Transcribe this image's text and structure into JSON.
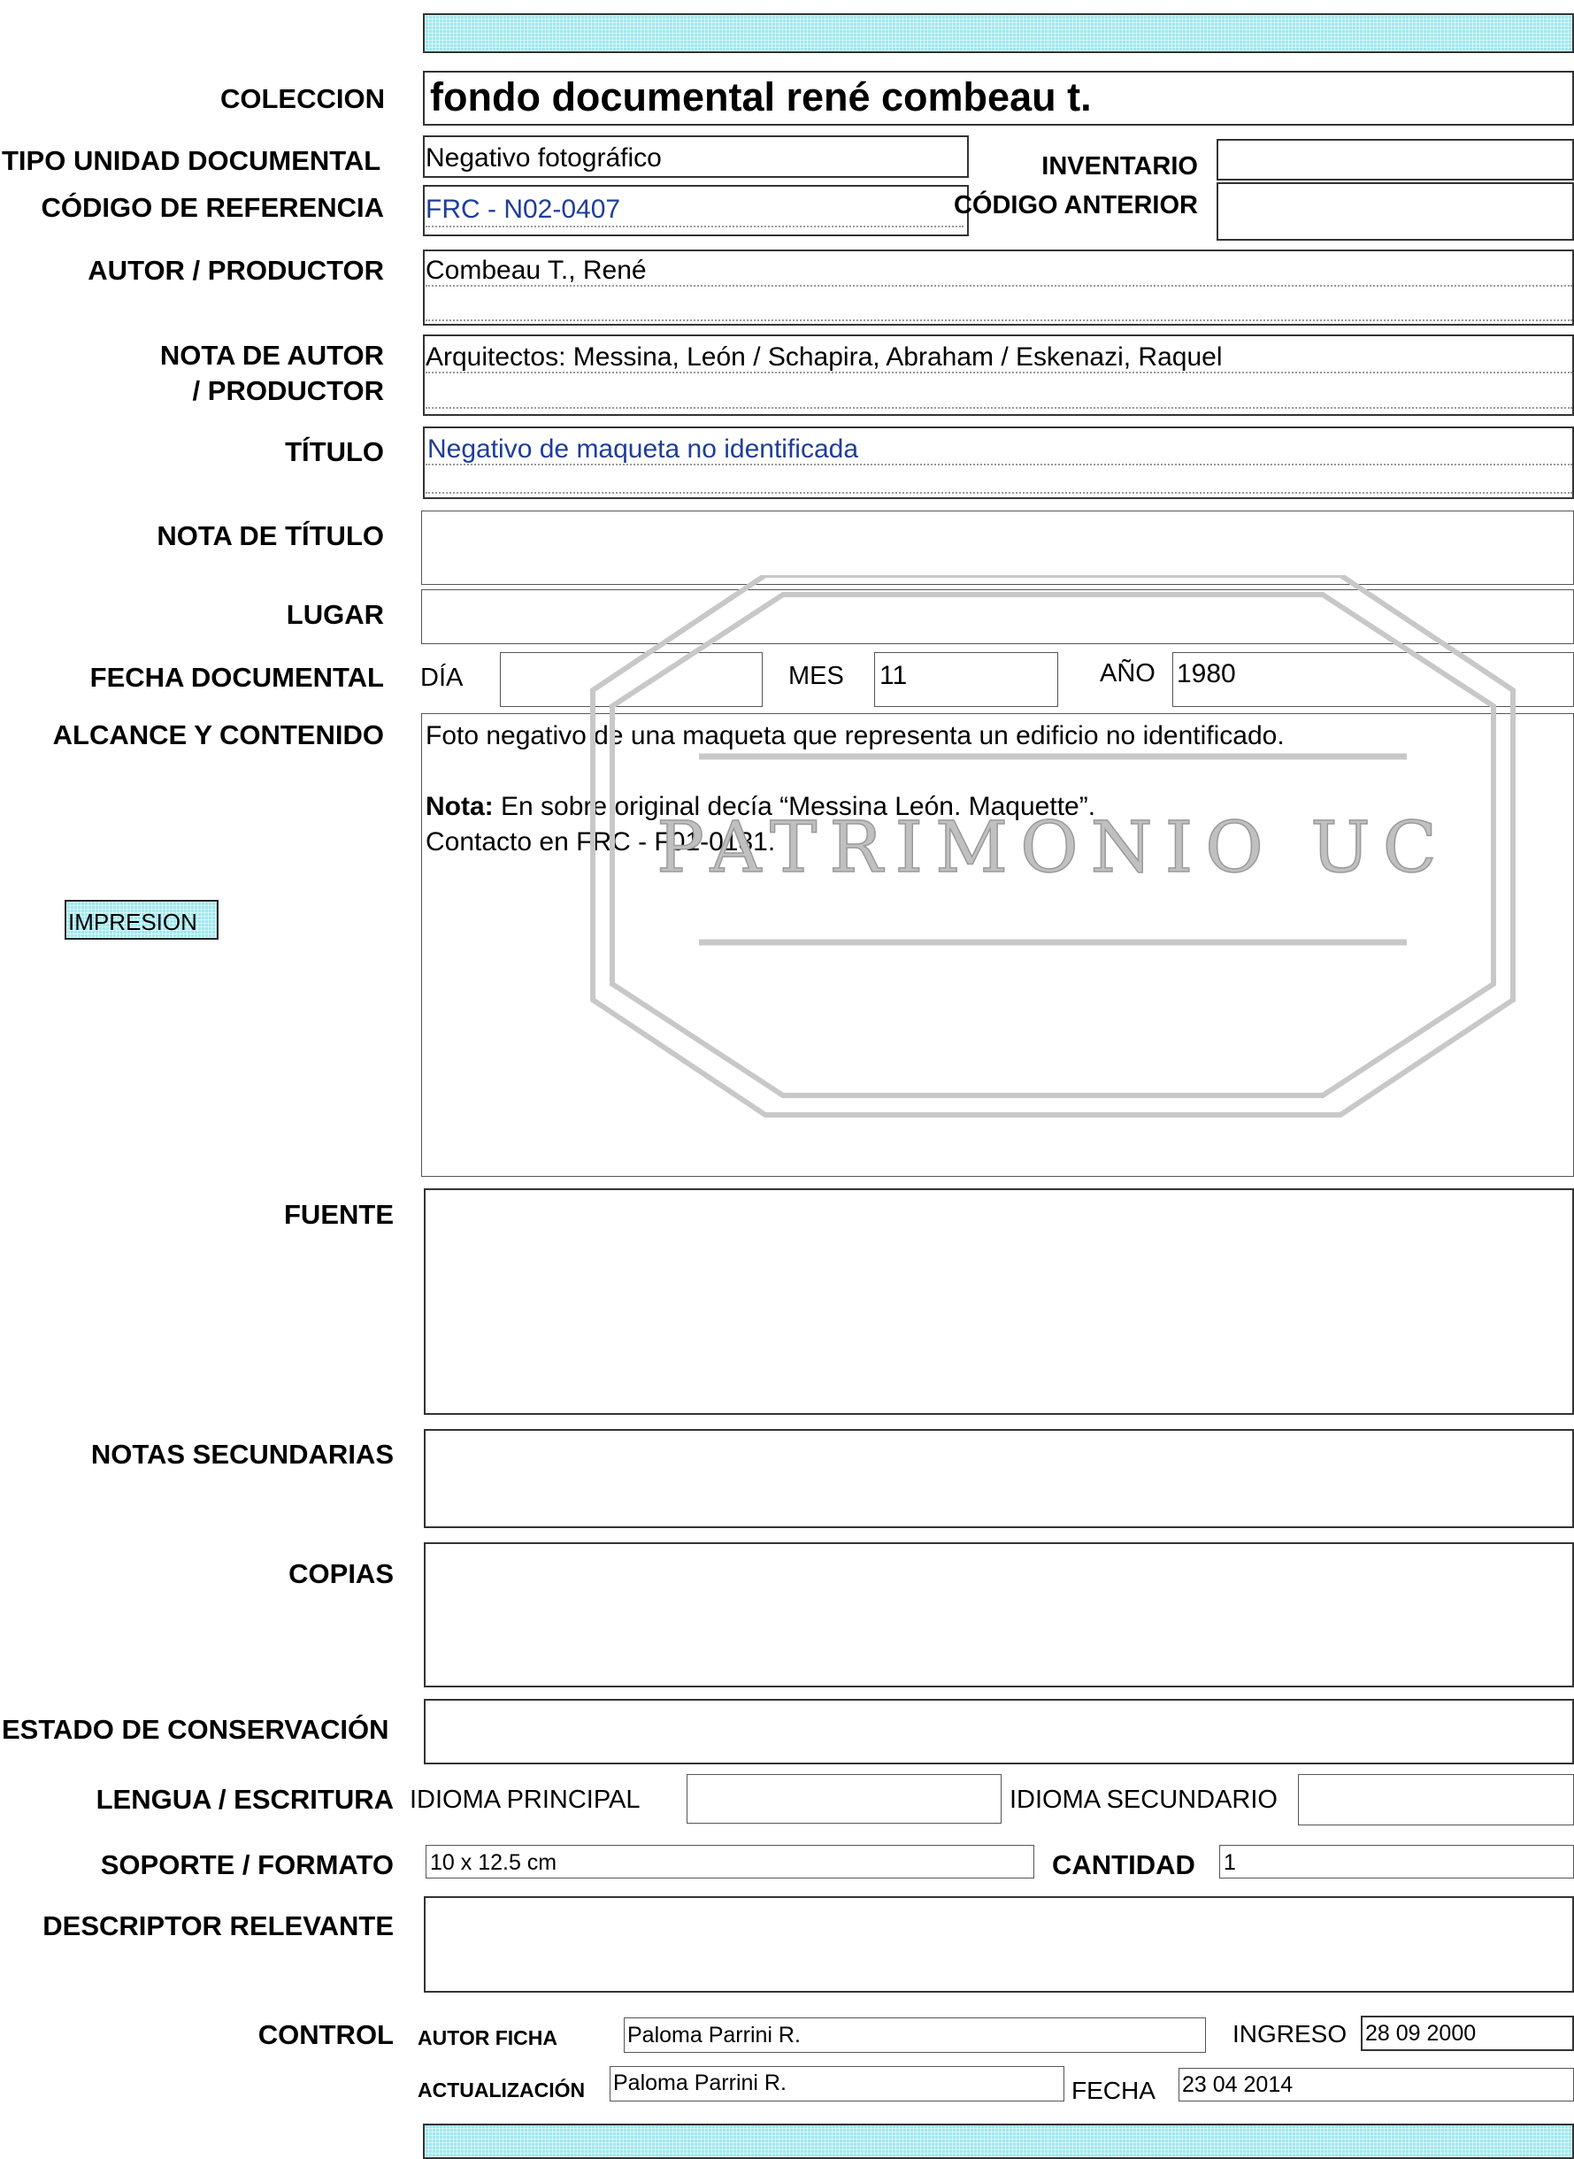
{
  "coleccion": {
    "label": "COLECCION",
    "value": "fondo documental rené combeau t."
  },
  "tipo_unidad": {
    "label": "TIPO UNIDAD DOCUMENTAL",
    "value": "Negativo fotográfico"
  },
  "inventario": {
    "label": "INVENTARIO",
    "value": ""
  },
  "codigo_referencia": {
    "label": "CÓDIGO DE REFERENCIA",
    "value": "FRC - N02-0407"
  },
  "codigo_anterior": {
    "label": "CÓDIGO ANTERIOR",
    "value": ""
  },
  "autor": {
    "label": "AUTOR / PRODUCTOR",
    "value": "Combeau T., René"
  },
  "nota_autor": {
    "label_line1": "NOTA DE AUTOR",
    "label_line2": "/ PRODUCTOR",
    "value": "Arquitectos: Messina, León / Schapira, Abraham / Eskenazi, Raquel"
  },
  "titulo": {
    "label": "TÍTULO",
    "value": "Negativo de maqueta no identificada"
  },
  "nota_titulo": {
    "label": "NOTA DE TÍTULO",
    "value": ""
  },
  "lugar": {
    "label": "LUGAR",
    "value": ""
  },
  "fecha": {
    "label": "FECHA DOCUMENTAL",
    "dia_label": "DÍA",
    "dia": "",
    "mes_label": "MES",
    "mes": "11",
    "anio_label": "AÑO",
    "anio": "1980"
  },
  "alcance": {
    "label": "ALCANCE Y CONTENIDO",
    "line1": "Foto negativo de una maqueta que representa un edificio no identificado.",
    "nota_bold": "Nota:",
    "nota_text": " En sobre original decía “Messina León. Maquette”.",
    "line3": "Contacto en FRC - F01-0131."
  },
  "impresion_button": "IMPRESION",
  "watermark_text": "PATRIMONIO UC",
  "fuente": {
    "label": "FUENTE",
    "value": ""
  },
  "notas_secundarias": {
    "label": "NOTAS SECUNDARIAS",
    "value": ""
  },
  "copias": {
    "label": "COPIAS",
    "value": ""
  },
  "estado": {
    "label": "ESTADO DE CONSERVACIÓN",
    "value": ""
  },
  "lengua": {
    "label": "LENGUA / ESCRITURA",
    "principal_label": "IDIOMA PRINCIPAL",
    "principal": "",
    "secundario_label": "IDIOMA SECUNDARIO",
    "secundario": ""
  },
  "soporte": {
    "label": "SOPORTE / FORMATO",
    "value": "10 x 12.5 cm",
    "cantidad_label": "CANTIDAD",
    "cantidad": "1"
  },
  "descriptor": {
    "label": "DESCRIPTOR RELEVANTE",
    "value": ""
  },
  "control": {
    "label": "CONTROL",
    "autor_ficha_label": "AUTOR FICHA",
    "autor_ficha": "Paloma Parrini R.",
    "ingreso_label": "INGRESO",
    "ingreso": "28 09 2000",
    "actualizacion_label": "ACTUALIZACIÓN",
    "actualizacion": "Paloma Parrini R.",
    "fecha_label": "FECHA",
    "fecha": "23 04 2014"
  },
  "colors": {
    "band": "#9ee8ee",
    "link": "#1f3d99",
    "watermark": "#c8c8c8"
  }
}
